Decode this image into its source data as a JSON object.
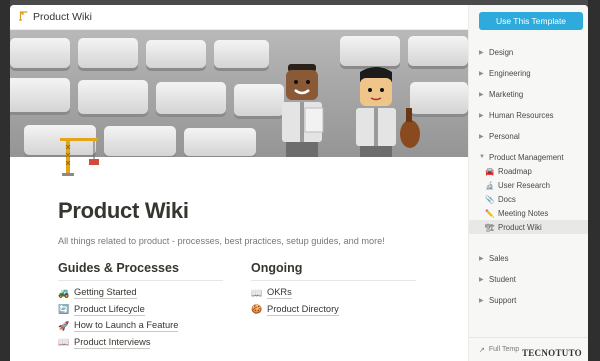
{
  "topbar": {
    "page_icon": "crane-icon",
    "page_label": "Product Wiki"
  },
  "page": {
    "icon": "crane-icon",
    "title": "Product Wiki",
    "subtitle": "All things related to product - processes, best practices, setup guides, and more!"
  },
  "sections": [
    {
      "heading": "Guides & Processes",
      "items": [
        {
          "emoji": "🚜",
          "label": "Getting Started"
        },
        {
          "emoji": "🔄",
          "label": "Product Lifecycle"
        },
        {
          "emoji": "🚀",
          "label": "How to Launch a Feature"
        },
        {
          "emoji": "📖",
          "label": "Product Interviews"
        }
      ]
    },
    {
      "heading": "Ongoing",
      "items": [
        {
          "emoji": "📖",
          "label": "OKRs"
        },
        {
          "emoji": "🍪",
          "label": "Product Directory"
        }
      ]
    }
  ],
  "sidebar": {
    "use_template_label": "Use This Template",
    "categories": [
      {
        "label": "Design",
        "expanded": false
      },
      {
        "label": "Engineering",
        "expanded": false
      },
      {
        "label": "Marketing",
        "expanded": false
      },
      {
        "label": "Human Resources",
        "expanded": false
      },
      {
        "label": "Personal",
        "expanded": false
      },
      {
        "label": "Product Management",
        "expanded": true
      },
      {
        "label": "Sales",
        "expanded": false
      },
      {
        "label": "Student",
        "expanded": false
      },
      {
        "label": "Support",
        "expanded": false
      }
    ],
    "product_management_items": [
      {
        "emoji": "🚘",
        "label": "Roadmap",
        "active": false
      },
      {
        "emoji": "🔬",
        "label": "User Research",
        "active": false
      },
      {
        "emoji": "📎",
        "label": "Docs",
        "active": false
      },
      {
        "emoji": "✏️",
        "label": "Meeting Notes",
        "active": false
      },
      {
        "emoji": "🏗",
        "label": "Product Wiki",
        "active": true
      }
    ],
    "footer_label": "Full Temp",
    "footer_icon": "arrow-icon"
  },
  "watermark": "TECNOTUTO",
  "colors": {
    "accent": "#2eaadc",
    "text": "#37352f",
    "sidebar_bg": "#f7f7f5"
  }
}
